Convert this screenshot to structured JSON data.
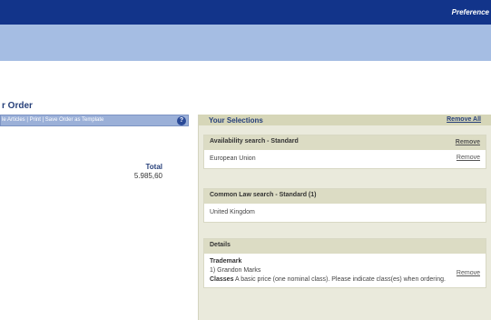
{
  "header": {
    "preferences_label": "Preference"
  },
  "page": {
    "title": "r Order"
  },
  "left_toolbar": {
    "links": "le Articles | Print | Save Order as Template",
    "help_icon": "question-circle-icon"
  },
  "order": {
    "total_label": "Total",
    "total_value": "5.985,60"
  },
  "selections": {
    "title": "Your Selections",
    "remove_all_label": "Remove All",
    "cards": [
      {
        "heading": "Availability search - Standard",
        "items": [
          {
            "text": "European Union",
            "remove_label": "Remove"
          }
        ],
        "heading_remove_label": "Remove"
      },
      {
        "heading": "Common Law search - Standard (1)",
        "items": [
          {
            "text": "United Kingdom"
          }
        ]
      },
      {
        "heading": "Details",
        "trademark_label": "Trademark",
        "trademark_item": "1) Grandon Marks",
        "item_remove_label": "Remove",
        "classes_label": "Classes",
        "classes_text": "A basic price (one nominal class). Please indicate class(es) when ordering."
      }
    ]
  }
}
